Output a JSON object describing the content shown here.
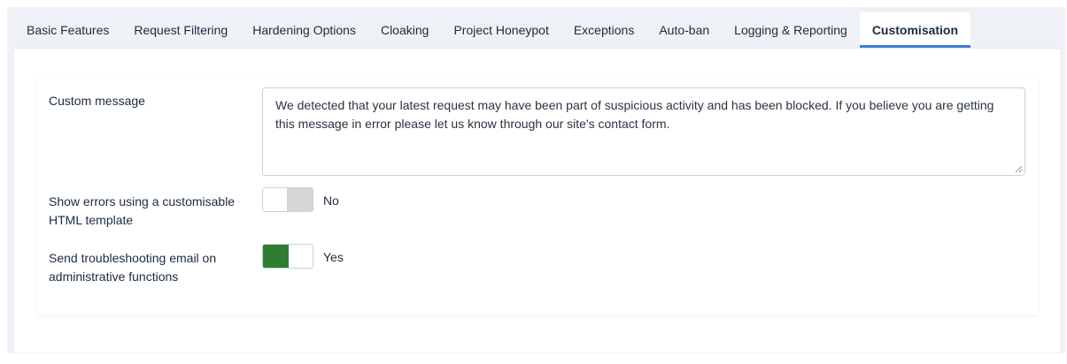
{
  "tabs": [
    {
      "label": "Basic Features",
      "active": false
    },
    {
      "label": "Request Filtering",
      "active": false
    },
    {
      "label": "Hardening Options",
      "active": false
    },
    {
      "label": "Cloaking",
      "active": false
    },
    {
      "label": "Project Honeypot",
      "active": false
    },
    {
      "label": "Exceptions",
      "active": false
    },
    {
      "label": "Auto-ban",
      "active": false
    },
    {
      "label": "Logging & Reporting",
      "active": false
    },
    {
      "label": "Customisation",
      "active": true
    }
  ],
  "form": {
    "custom_message": {
      "label": "Custom message",
      "value": "We detected that your latest request may have been part of suspicious activity and has been blocked. If you believe you are getting this message in error please let us know through our site's contact form."
    },
    "show_errors": {
      "label_line1": "Show errors using a customisable",
      "label_line2": "HTML template",
      "state": "No"
    },
    "send_email": {
      "label_line1": "Send troubleshooting email on",
      "label_line2": "administrative functions",
      "state": "Yes"
    }
  },
  "colors": {
    "accent": "#3f7fd0",
    "toggle_on": "#2e7d32",
    "toggle_off": "#d6d6d6",
    "panel_background": "#eef2f6"
  }
}
